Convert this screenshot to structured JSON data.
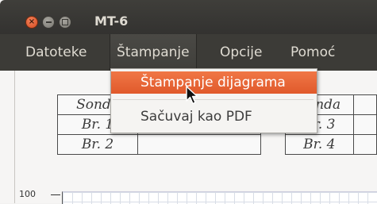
{
  "window": {
    "title": "MT-6",
    "controls": {
      "close": "×",
      "minimize": "",
      "maximize": ""
    }
  },
  "menubar": {
    "items": [
      {
        "label": "Datoteke"
      },
      {
        "label": "Štampanje"
      },
      {
        "label": "Opcije"
      },
      {
        "label": "Pomoć"
      }
    ]
  },
  "dropdown": {
    "items": [
      {
        "label": "Štampanje dijagrama"
      },
      {
        "label": "Sačuvaj kao PDF"
      }
    ]
  },
  "tables": {
    "left": {
      "header": "Sonda",
      "rows": [
        "Br. 1",
        "Br. 2"
      ]
    },
    "right": {
      "header": "Sonda",
      "rows": [
        "Br. 3",
        "Br. 4"
      ]
    }
  },
  "graph": {
    "y_max_label": "100"
  },
  "colors": {
    "highlight": "#e95f2f",
    "menubar": "#3c3b37",
    "titlebar": "#3a3935"
  }
}
